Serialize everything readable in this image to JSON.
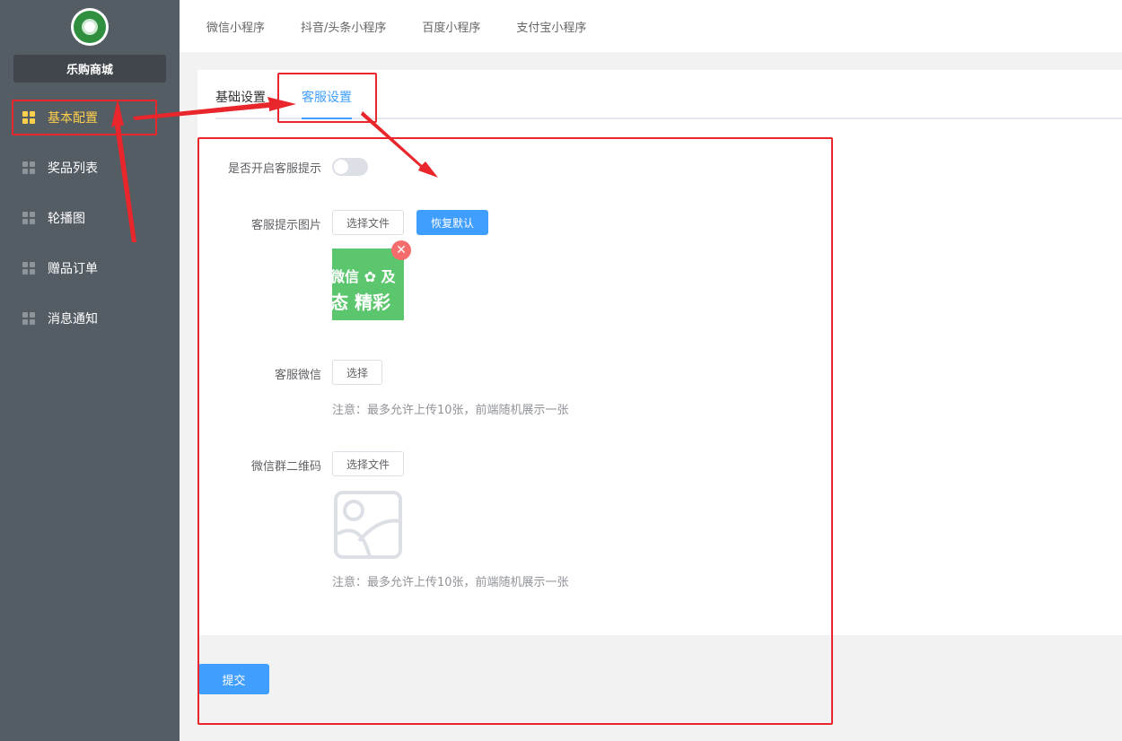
{
  "sidebar": {
    "shop_name": "乐购商城",
    "items": [
      {
        "label": "基本配置",
        "active": true
      },
      {
        "label": "奖品列表",
        "active": false
      },
      {
        "label": "轮播图",
        "active": false
      },
      {
        "label": "赠品订单",
        "active": false
      },
      {
        "label": "消息通知",
        "active": false
      }
    ]
  },
  "top_tabs": [
    "微信小程序",
    "抖音/头条小程序",
    "百度小程序",
    "支付宝小程序"
  ],
  "sub_tabs": {
    "basic": "基础设置",
    "service": "客服设置"
  },
  "form": {
    "toggle_label": "是否开启客服提示",
    "toggle_on": false,
    "image_label": "客服提示图片",
    "choose_file": "选择文件",
    "restore_default": "恢复默认",
    "thumb_row1": "微信 ✿ 及",
    "thumb_row2": "态 精彩",
    "wechat_label": "客服微信",
    "choose": "选择",
    "note1": "注意：最多允许上传10张，前端随机展示一张",
    "qr_label": "微信群二维码",
    "choose_file_qr": "选择文件",
    "note2": "注意：最多允许上传10张，前端随机展示一张"
  },
  "submit_label": "提交",
  "colors": {
    "sidebar": "#545c64",
    "active": "#ffd04b",
    "primary": "#409eff",
    "annotation": "#e8262b"
  }
}
